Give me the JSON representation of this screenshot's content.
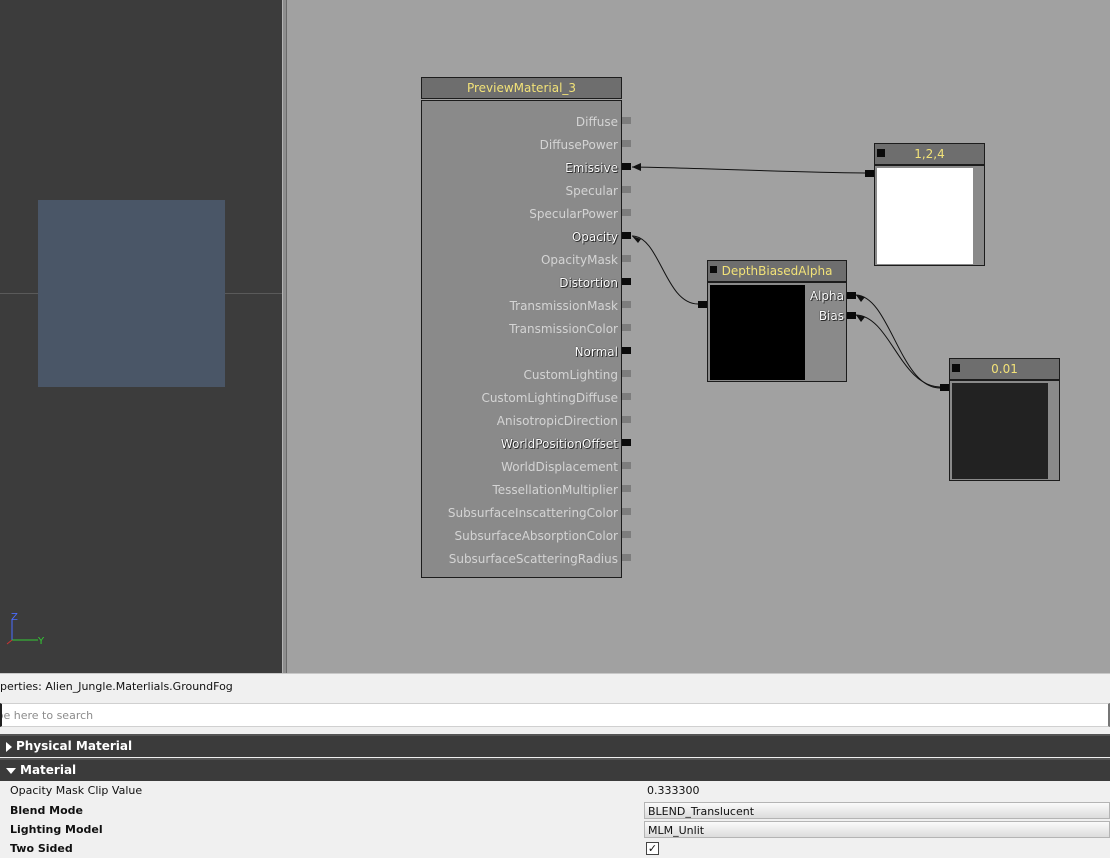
{
  "viewport": {
    "axis_z": "Z",
    "axis_y": "Y"
  },
  "material_node": {
    "title": "PreviewMaterial_3",
    "inputs": [
      {
        "label": "Diffuse",
        "connected": false
      },
      {
        "label": "DiffusePower",
        "connected": false
      },
      {
        "label": "Emissive",
        "connected": true
      },
      {
        "label": "Specular",
        "connected": false
      },
      {
        "label": "SpecularPower",
        "connected": false
      },
      {
        "label": "Opacity",
        "connected": true
      },
      {
        "label": "OpacityMask",
        "connected": false
      },
      {
        "label": "Distortion",
        "connected": true
      },
      {
        "label": "TransmissionMask",
        "connected": false
      },
      {
        "label": "TransmissionColor",
        "connected": false
      },
      {
        "label": "Normal",
        "connected": true
      },
      {
        "label": "CustomLighting",
        "connected": false
      },
      {
        "label": "CustomLightingDiffuse",
        "connected": false
      },
      {
        "label": "AnisotropicDirection",
        "connected": false
      },
      {
        "label": "WorldPositionOffset",
        "connected": true
      },
      {
        "label": "WorldDisplacement",
        "connected": false
      },
      {
        "label": "TessellationMultiplier",
        "connected": false
      },
      {
        "label": "SubsurfaceInscatteringColor",
        "connected": false
      },
      {
        "label": "SubsurfaceAbsorptionColor",
        "connected": false
      },
      {
        "label": "SubsurfaceScatteringRadius",
        "connected": false
      }
    ]
  },
  "constant_vector_node": {
    "title": "1,2,4",
    "preview_color": "#ffffff"
  },
  "depth_biased_node": {
    "title": "DepthBiasedAlpha",
    "inputs": [
      "Alpha",
      "Bias"
    ],
    "preview_color": "#000000"
  },
  "constant_node": {
    "title": "0.01",
    "preview_color": "#222222"
  },
  "properties": {
    "title": "perties: Alien_Jungle.Materlials.GroundFog",
    "search_placeholder": "ype here to search",
    "categories": {
      "physical": "Physical Material",
      "material": "Material"
    },
    "rows": {
      "opacity_mask_clip": {
        "name": "Opacity Mask Clip Value",
        "value": "0.333300"
      },
      "blend_mode": {
        "name": "Blend Mode",
        "value": "BLEND_Translucent"
      },
      "lighting_model": {
        "name": "Lighting Model",
        "value": "MLM_Unlit"
      },
      "two_sided": {
        "name": "Two Sided",
        "checked": true,
        "check_glyph": "✓"
      }
    }
  },
  "colors": {
    "node_title_text": "#f2e278",
    "canvas_bg": "#a1a1a1",
    "viewport_bg": "#3c3c3c",
    "category_bg": "#3b3b3b",
    "axis_z": "#4a6cff",
    "axis_y": "#33cc33"
  }
}
